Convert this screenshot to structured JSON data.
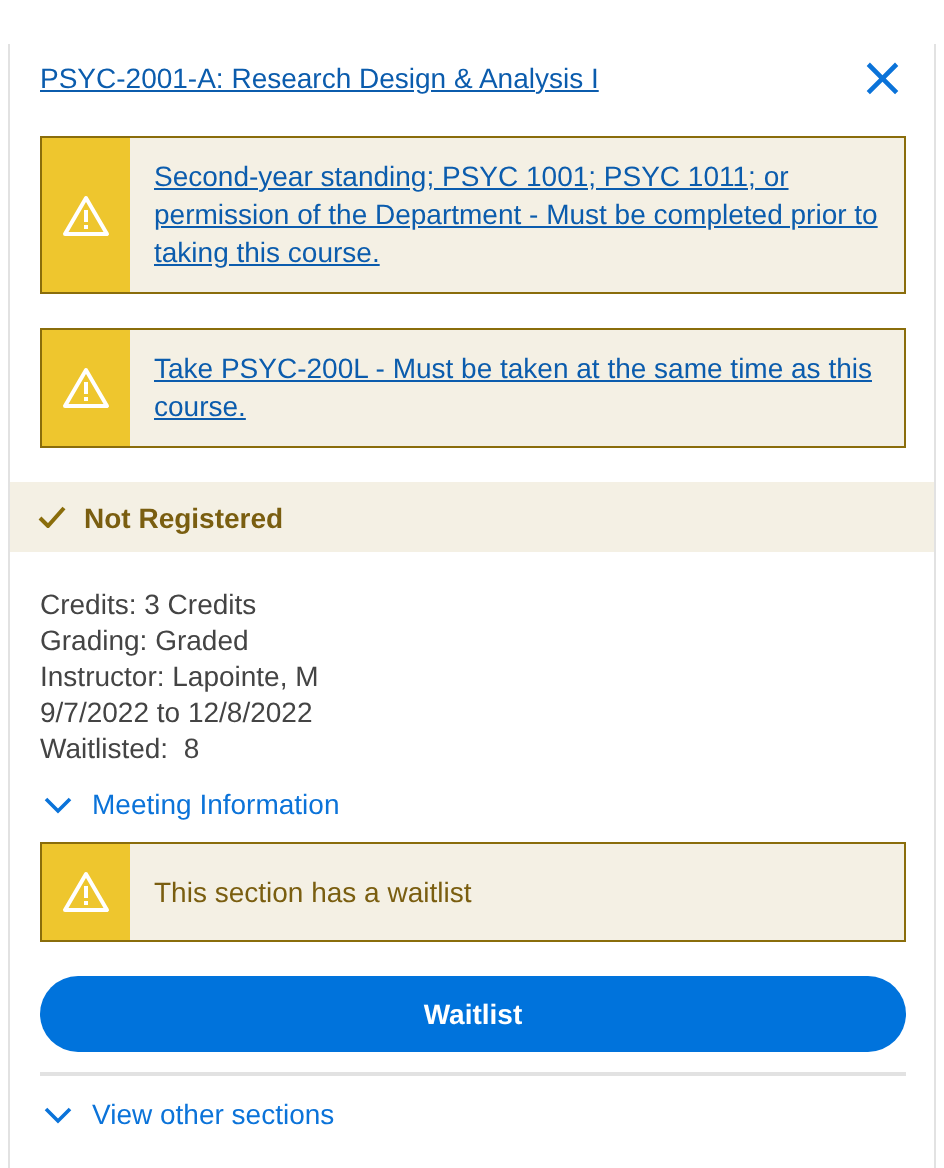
{
  "course_link": "PSYC-2001-A: Research Design & Analysis I",
  "close": "×",
  "requisites": [
    {
      "kind": "link",
      "text": "Second-year standing; PSYC 1001; PSYC 1011; or permission of the Department - Must be completed prior to taking this course."
    },
    {
      "kind": "link",
      "text": "Take PSYC-200L - Must be taken at the same time as this course."
    }
  ],
  "status": "Not Registered",
  "details": [
    "Credits: 3 Credits",
    "Grading: Graded",
    "Instructor: Lapointe, M",
    "9/7/2022 to 12/8/2022",
    "Waitlisted:  8"
  ],
  "meeting_toggle": {
    "label": "Meeting Information",
    "expanded": false
  },
  "notice": {
    "kind": "text",
    "text": "This section has a waitlist"
  },
  "action_button": "Waitlist",
  "sections_toggle": {
    "label": "View other sections",
    "expanded": false
  }
}
